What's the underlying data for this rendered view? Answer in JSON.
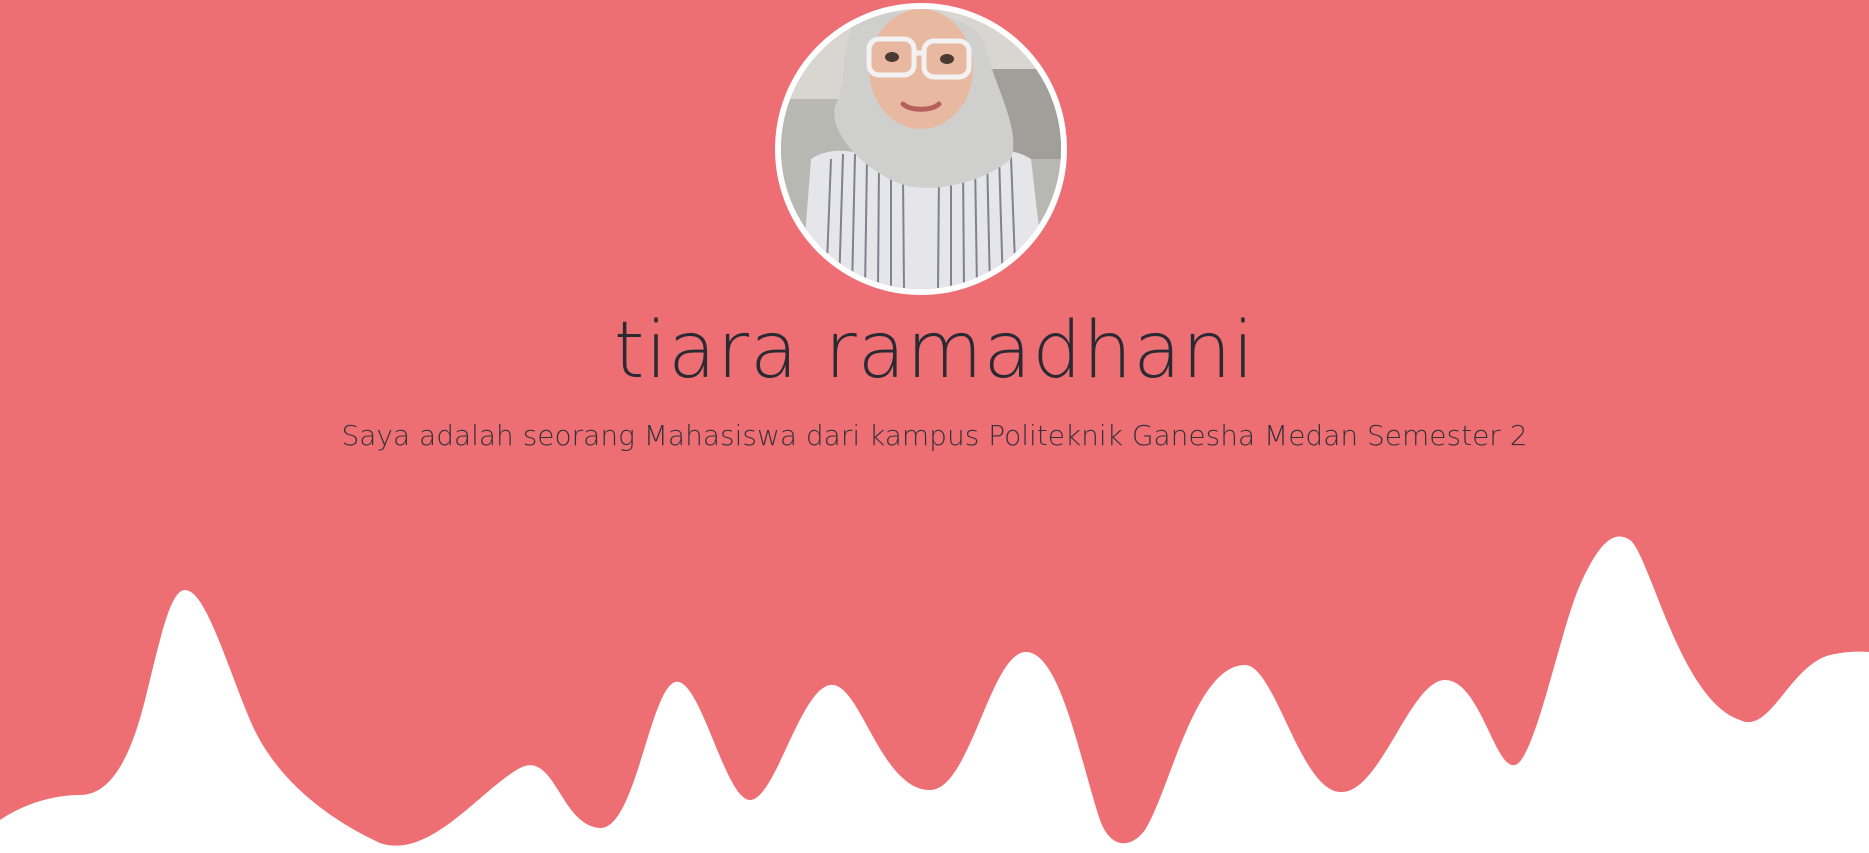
{
  "profile": {
    "name": "tiara ramadhani",
    "tagline": "Saya adalah seorang Mahasiswa dari kampus Politeknik Ganesha Medan Semester 2",
    "avatar_icon": "profile-photo"
  },
  "theme": {
    "background": "#ed6f74",
    "wave": "#ffffff",
    "text": "#2b2a33"
  }
}
